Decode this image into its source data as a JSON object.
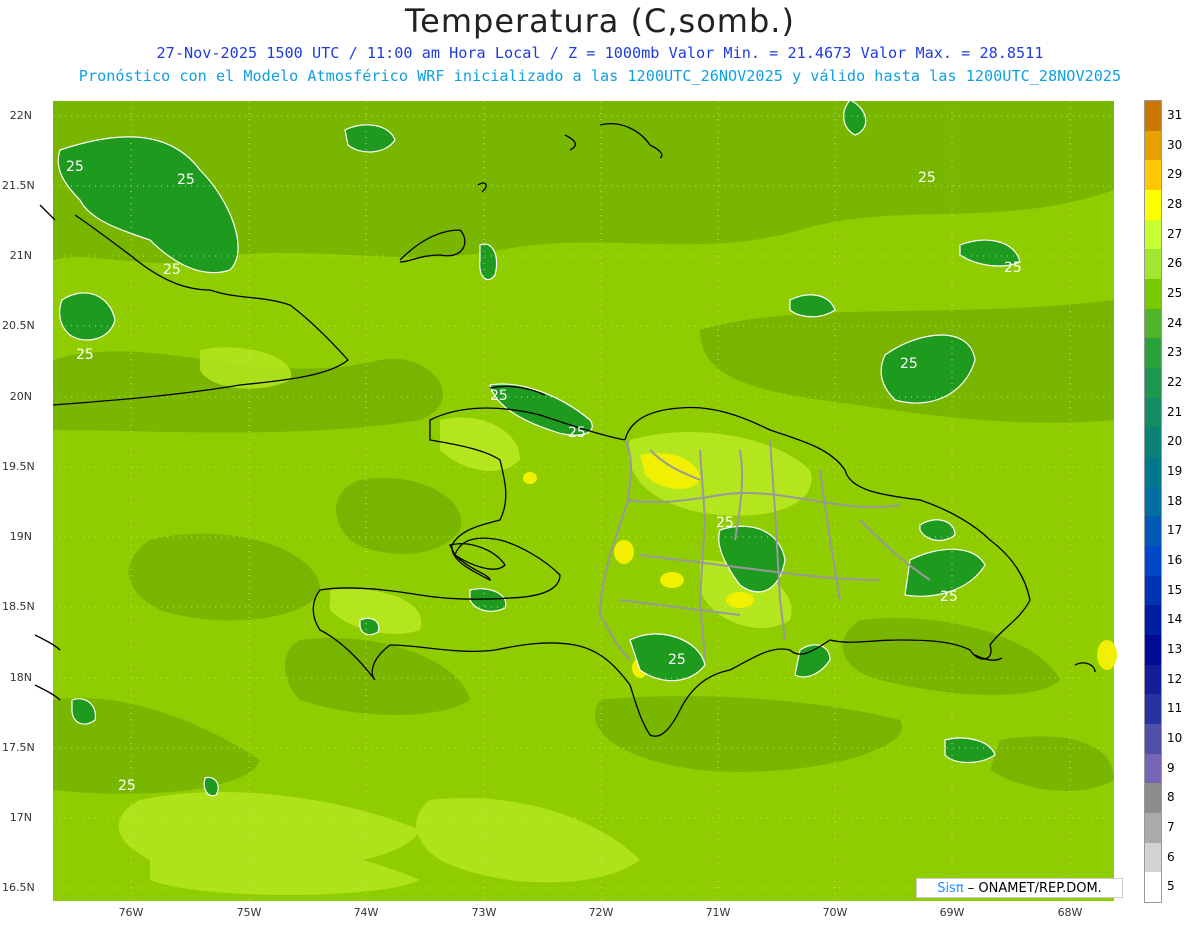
{
  "header": {
    "title": "Temperatura (C,somb.)",
    "subtitle1": "27-Nov-2025 1500 UTC / 11:00 am Hora Local / Z = 1000mb  Valor Min. = 21.4673  Valor Max. = 28.8511",
    "subtitle2": "Pronóstico con el Modelo Atmosférico WRF inicializado a las 1200UTC_26NOV2025 y válido hasta las  1200UTC_28NOV2025"
  },
  "axes": {
    "lat_labels": [
      "22N",
      "21.5N",
      "21N",
      "20.5N",
      "20N",
      "19.5N",
      "19N",
      "18.5N",
      "18N",
      "17.5N",
      "17N",
      "16.5N"
    ],
    "lon_labels": [
      "76W",
      "75W",
      "74W",
      "73W",
      "72W",
      "71W",
      "70W",
      "69W",
      "68W"
    ]
  },
  "contour_labels": [
    "25",
    "25",
    "25",
    "25",
    "25",
    "25",
    "25",
    "25",
    "25",
    "25",
    "25",
    "25",
    "25"
  ],
  "colorbar": {
    "labels": [
      "31",
      "30",
      "29",
      "28",
      "27",
      "26",
      "25",
      "24",
      "23",
      "22",
      "21",
      "20",
      "19",
      "18",
      "17",
      "16",
      "15",
      "14",
      "13",
      "12",
      "11",
      "10",
      "9",
      "8",
      "7",
      "6",
      "5"
    ],
    "colors": [
      "#c87800",
      "#e6a000",
      "#ffc800",
      "#ffff00",
      "#c8ff32",
      "#a0e632",
      "#78c800",
      "#50b428",
      "#28a03c",
      "#1e9650",
      "#148c64",
      "#0a8278",
      "#00788c",
      "#006ea0",
      "#005ab4",
      "#0046c8",
      "#0032b4",
      "#001ea0",
      "#000a96",
      "#141e96",
      "#2832a0",
      "#5050aa",
      "#7864b4",
      "#8c8c8c",
      "#aaaaaa",
      "#d2d2d2",
      "#ffffff"
    ]
  },
  "colors": {
    "sea_base": "#8fcc00",
    "band_dark": "#78b400",
    "warm_light": "#b4e61e",
    "hot_yellow": "#f0f000",
    "cool_green": "#1e9a1e",
    "coast": "#000000",
    "border": "#999999"
  },
  "credit": {
    "brand": "Sisπ",
    "text": " – ONAMET/REP.DOM."
  }
}
